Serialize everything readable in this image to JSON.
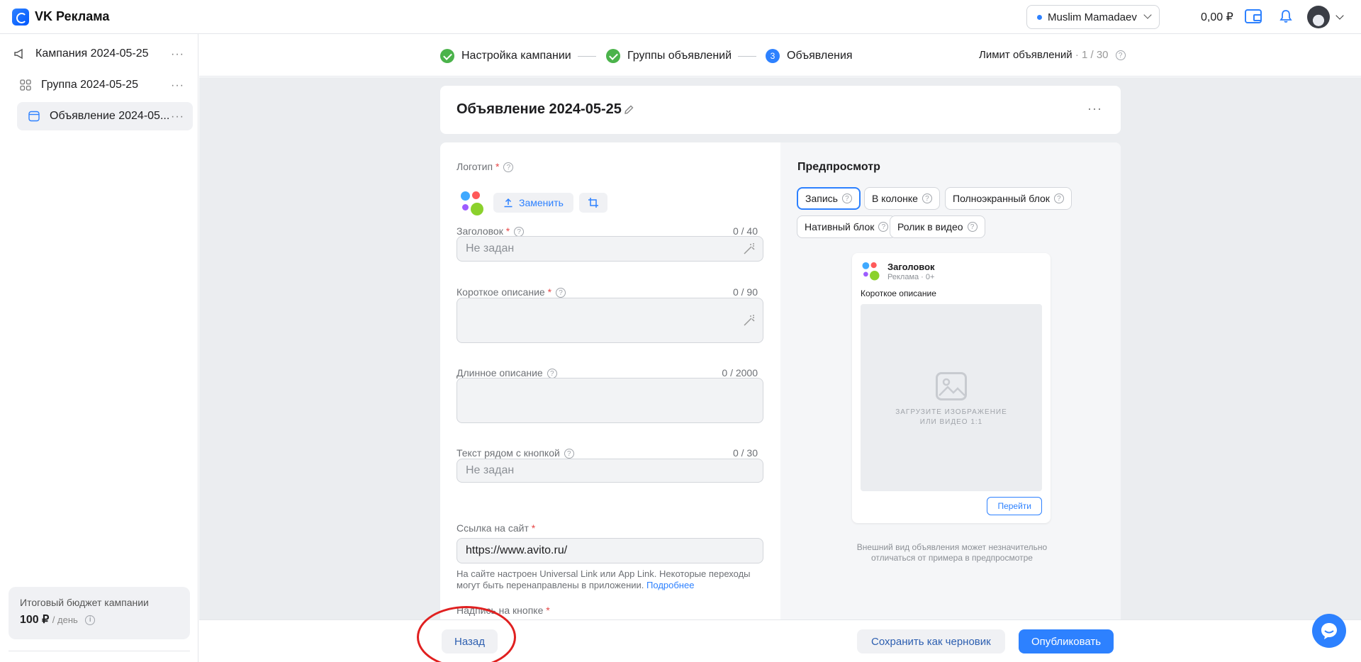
{
  "app": {
    "name": "VK Реклама"
  },
  "header": {
    "user": "Muslim Mamadaev",
    "balance": "0,00 ₽"
  },
  "sidebar": {
    "items": [
      {
        "label": "Кампания 2024-05-25",
        "more": "···"
      },
      {
        "label": "Группа 2024-05-25",
        "more": "···"
      },
      {
        "label": "Объявление 2024-05...",
        "more": "···"
      }
    ],
    "budget": {
      "title": "Итоговый бюджет кампании",
      "value": "100 ₽",
      "unit": "/ день"
    }
  },
  "stepper": {
    "steps": [
      {
        "label": "Настройка кампании",
        "state": "done"
      },
      {
        "label": "Группы объявлений",
        "state": "done"
      },
      {
        "label": "Объявления",
        "number": "3",
        "state": "current"
      }
    ],
    "limit_label": "Лимит объявлений",
    "limit_value": "· 1 / 30"
  },
  "ad": {
    "title": "Объявление 2024-05-25",
    "more": "···"
  },
  "form": {
    "logo": {
      "label": "Логотип",
      "replace": "Заменить"
    },
    "headline": {
      "label": "Заголовок",
      "counter": "0 / 40",
      "placeholder": "Не задан"
    },
    "short_desc": {
      "label": "Короткое описание",
      "counter": "0 / 90"
    },
    "long_desc": {
      "label": "Длинное описание",
      "counter": "0 / 2000"
    },
    "button_text": {
      "label": "Текст рядом с кнопкой",
      "counter": "0 / 30",
      "placeholder": "Не задан"
    },
    "site_link": {
      "label": "Ссылка на сайт",
      "value": "https://www.avito.ru/"
    },
    "hint": "На сайте настроен Universal Link или App Link. Некоторые переходы могут быть перенаправлены в приложении.",
    "hint_link": "Подробнее",
    "button_label": {
      "label": "Надпись на кнопке"
    }
  },
  "preview": {
    "title": "Предпросмотр",
    "tabs": [
      "Запись",
      "В колонке",
      "Полноэкранный блок",
      "Нативный блок",
      "Ролик в видео"
    ],
    "selected_tab": "Запись",
    "card": {
      "headline": "Заголовок",
      "sub": "Реклама · 0+",
      "desc": "Короткое описание",
      "media_caption_1": "ЗАГРУЗИТЕ ИЗОБРАЖЕНИЕ",
      "media_caption_2": "ИЛИ ВИДЕО 1:1",
      "cta": "Перейти"
    },
    "note": "Внешний вид объявления может незначительно отличаться от примера в предпросмотре"
  },
  "footer": {
    "back": "Назад",
    "draft": "Сохранить как черновик",
    "publish": "Опубликовать"
  },
  "colors": {
    "accent": "#2d81ff",
    "success": "#4bb34b",
    "required": "#e64646",
    "annotation": "#e02020"
  }
}
